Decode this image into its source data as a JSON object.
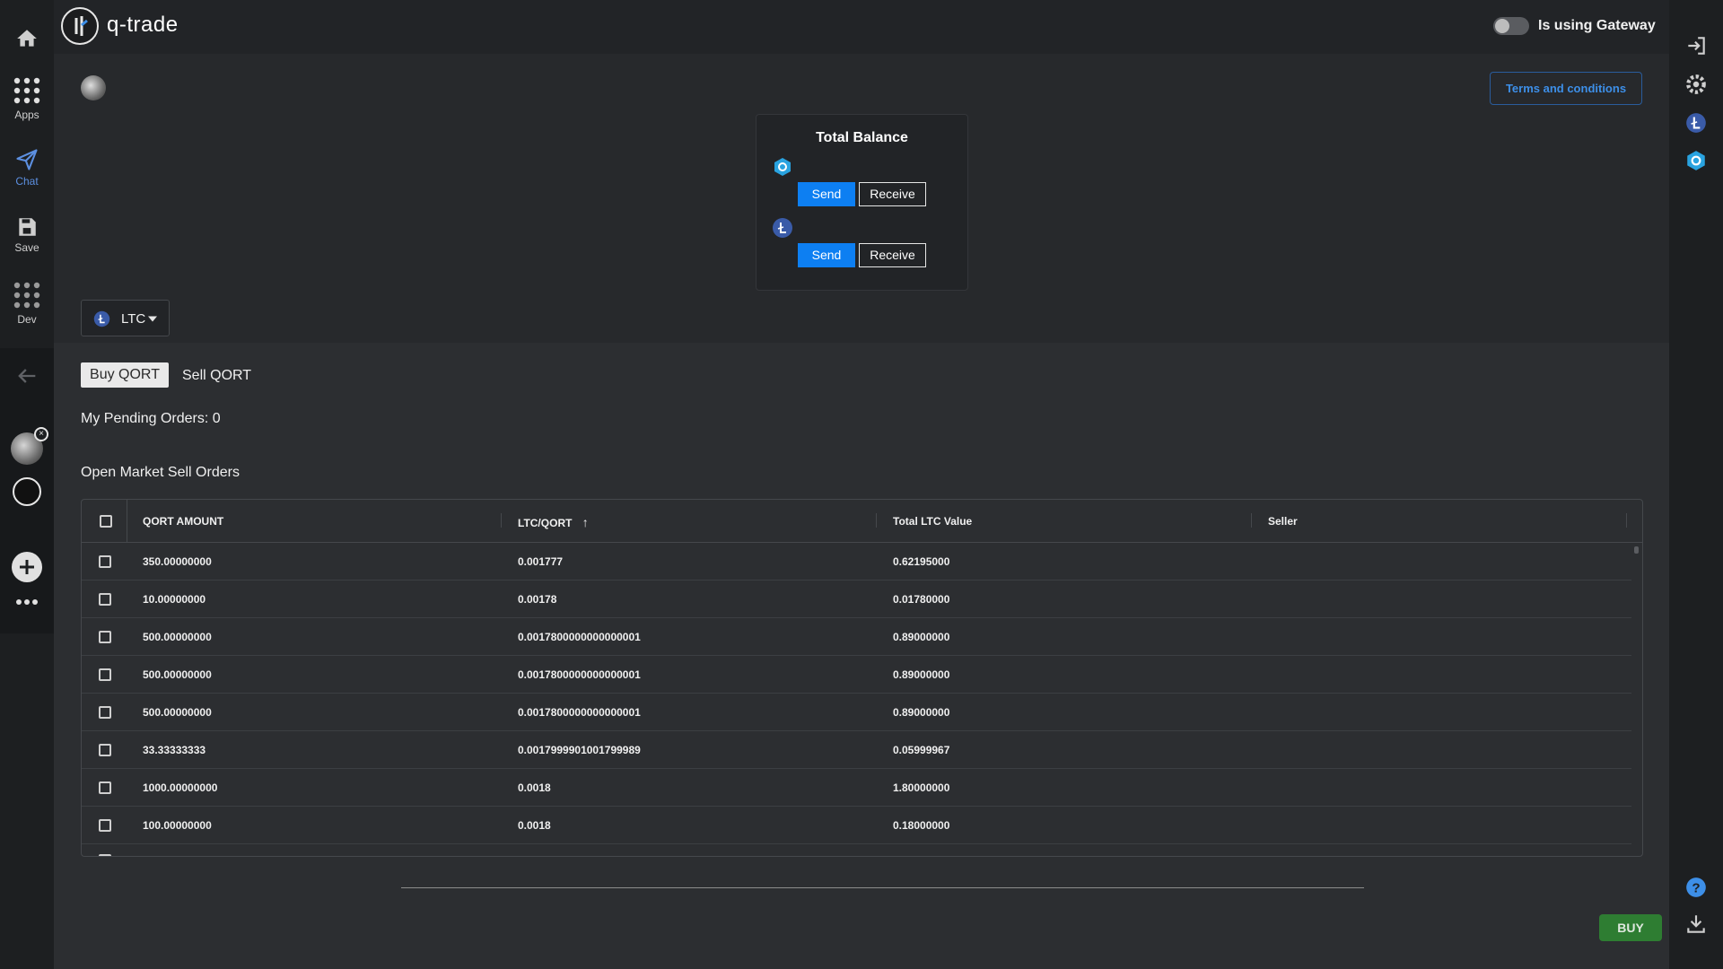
{
  "app": {
    "title": "q-trade"
  },
  "gateway": {
    "label": "Is using Gateway",
    "enabled": false
  },
  "sidebar": {
    "items": [
      {
        "name": "home",
        "label": ""
      },
      {
        "name": "apps",
        "label": "Apps"
      },
      {
        "name": "chat",
        "label": "Chat"
      },
      {
        "name": "save",
        "label": "Save"
      },
      {
        "name": "dev",
        "label": "Dev"
      }
    ]
  },
  "header": {
    "terms_label": "Terms and conditions"
  },
  "balance": {
    "title": "Total Balance",
    "send_label": "Send",
    "receive_label": "Receive"
  },
  "coin_select": {
    "value": "LTC"
  },
  "tabs": {
    "buy": "Buy QORT",
    "sell": "Sell QORT"
  },
  "pending": {
    "text": "My Pending Orders: 0"
  },
  "orders": {
    "title": "Open Market Sell Orders",
    "columns": [
      "QORT AMOUNT",
      "LTC/QORT",
      "Total LTC Value",
      "Seller"
    ],
    "sort_indicator": "↑",
    "rows": [
      {
        "amount": "350.00000000",
        "price": "0.001777",
        "total": "0.62195000",
        "seller": ""
      },
      {
        "amount": "10.00000000",
        "price": "0.00178",
        "total": "0.01780000",
        "seller": ""
      },
      {
        "amount": "500.00000000",
        "price": "0.0017800000000000001",
        "total": "0.89000000",
        "seller": ""
      },
      {
        "amount": "500.00000000",
        "price": "0.0017800000000000001",
        "total": "0.89000000",
        "seller": ""
      },
      {
        "amount": "500.00000000",
        "price": "0.0017800000000000001",
        "total": "0.89000000",
        "seller": ""
      },
      {
        "amount": "33.33333333",
        "price": "0.0017999901001799989",
        "total": "0.05999967",
        "seller": ""
      },
      {
        "amount": "1000.00000000",
        "price": "0.0018",
        "total": "1.80000000",
        "seller": ""
      },
      {
        "amount": "100.00000000",
        "price": "0.0018",
        "total": "0.18000000",
        "seller": ""
      }
    ]
  },
  "buy_button": {
    "label": "BUY"
  },
  "colors": {
    "accent": "#0d7ff2",
    "buy": "#2e7d32",
    "terms": "#3d8fe8",
    "background": "#27292c"
  }
}
